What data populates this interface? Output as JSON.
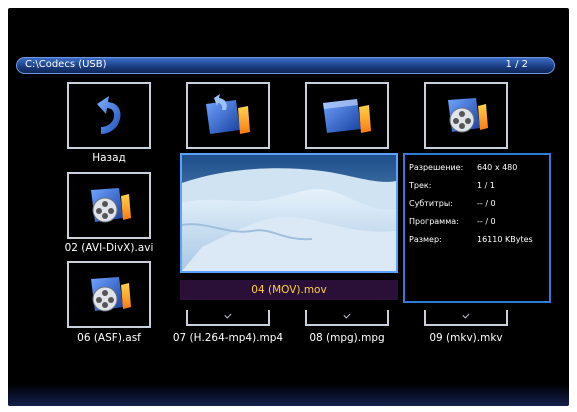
{
  "header": {
    "path": "C:\\Codecs (USB)",
    "page": "1 / 2"
  },
  "tiles": [
    {
      "caption": "Назад"
    },
    {
      "caption": ""
    },
    {
      "caption": ""
    },
    {
      "caption": ""
    },
    {
      "caption": "02 (AVI-DivX).avi"
    },
    {
      "caption": "06 (ASF).asf"
    },
    {
      "caption": "07 (H.264-mp4).mp4"
    },
    {
      "caption": "08 (mpg).mpg"
    },
    {
      "caption": "09 (mkv).mkv"
    }
  ],
  "selected": {
    "name": "04 (MOV).mov"
  },
  "info": [
    {
      "key": "Разрешение:",
      "value": "640 x 480"
    },
    {
      "key": "Трек:",
      "value": "1 / 1"
    },
    {
      "key": "Субтитры:",
      "value": "-- / 0"
    },
    {
      "key": "Программа:",
      "value": "-- / 0"
    },
    {
      "key": "Размер:",
      "value": "16110 KBytes"
    }
  ],
  "colors": {
    "pathbar": "#1b3f86",
    "selected_text": "#ffd23a",
    "info_border": "#2f7bd8"
  }
}
